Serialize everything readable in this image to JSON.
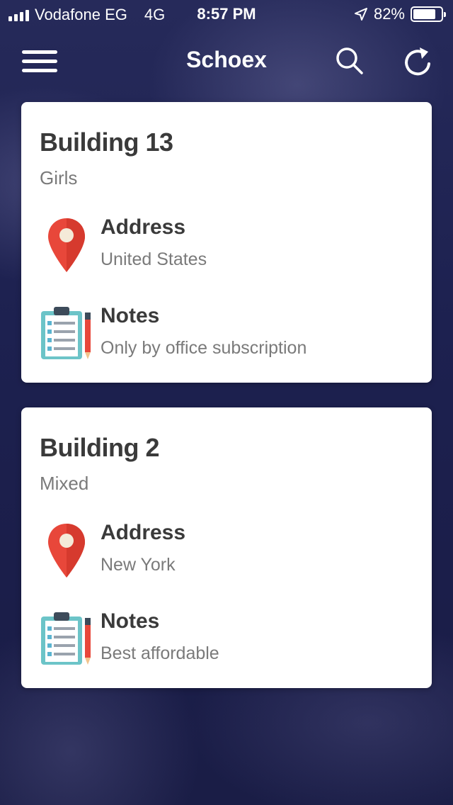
{
  "status_bar": {
    "carrier": "Vodafone EG",
    "network": "4G",
    "time": "8:57 PM",
    "battery": "82%",
    "battery_level": 0.82
  },
  "nav": {
    "title": "Schoex",
    "menu_icon": "hamburger-menu-icon",
    "search_icon": "search-icon",
    "refresh_icon": "refresh-icon"
  },
  "buildings": [
    {
      "name": "Building 13",
      "type": "Girls",
      "address_label": "Address",
      "address": "United States",
      "notes_label": "Notes",
      "notes": "Only by office subscription"
    },
    {
      "name": "Building 2",
      "type": "Mixed",
      "address_label": "Address",
      "address": "New York",
      "notes_label": "Notes",
      "notes": "Best affordable"
    }
  ],
  "colors": {
    "background": "#1f2350",
    "card": "#ffffff",
    "pin": "#e8473a",
    "text_primary": "#3a3a3a",
    "text_secondary": "#7a7a7a"
  }
}
